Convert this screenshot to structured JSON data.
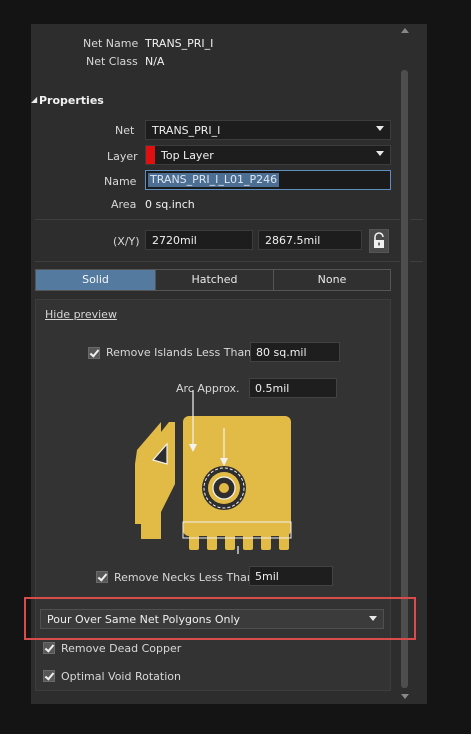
{
  "net_info": {
    "net_name_label": "Net Name",
    "net_name_value": "TRANS_PRI_I",
    "net_class_label": "Net Class",
    "net_class_value": "N/A"
  },
  "properties": {
    "title": "Properties",
    "net_label": "Net",
    "net_value": "TRANS_PRI_I",
    "layer_label": "Layer",
    "layer_value": "Top Layer",
    "layer_color": "#e01010",
    "name_label": "Name",
    "name_value": "TRANS_PRI_I_L01_P246",
    "area_label": "Area",
    "area_value": "0 sq.inch",
    "xy_label": "(X/Y)",
    "x_value": "2720mil",
    "y_value": "2867.5mil",
    "lock_icon": "lock-icon"
  },
  "fill_mode": {
    "tabs": [
      "Solid",
      "Hatched",
      "None"
    ],
    "active": "Solid",
    "active_color": "#557aa0"
  },
  "preview": {
    "hide_label": "Hide preview",
    "remove_islands_label": "Remove Islands Less Than",
    "remove_islands_checked": true,
    "remove_islands_value": "80 sq.mil",
    "arc_approx_label": "Arc Approx.",
    "arc_approx_value": "0.5mil",
    "remove_necks_label": "Remove Necks Less Than",
    "remove_necks_checked": true,
    "remove_necks_value": "5mil",
    "copper_color": "#e2bb46"
  },
  "pour": {
    "selected": "Pour Over Same Net Polygons Only",
    "highlight_color": "#d84c4c"
  },
  "options": {
    "remove_dead_copper_label": "Remove Dead Copper",
    "remove_dead_copper_checked": true,
    "optimal_void_rotation_label": "Optimal Void Rotation",
    "optimal_void_rotation_checked": true
  }
}
